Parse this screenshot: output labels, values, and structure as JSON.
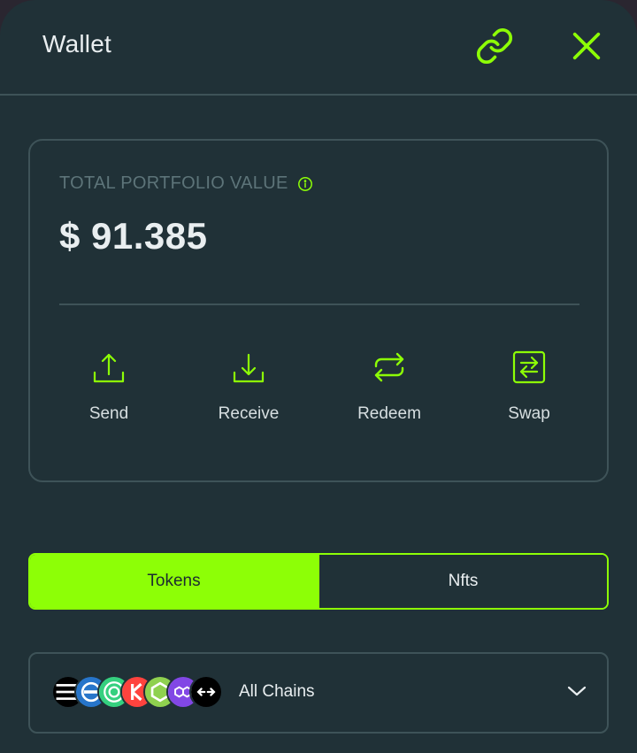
{
  "header": {
    "title": "Wallet",
    "link_icon": "link-icon",
    "close_icon": "close-icon"
  },
  "portfolio": {
    "label": "TOTAL PORTFOLIO VALUE",
    "info_icon": "info-icon",
    "value": "$ 91.385"
  },
  "actions": [
    {
      "label": "Send",
      "icon": "upload-icon"
    },
    {
      "label": "Receive",
      "icon": "download-icon"
    },
    {
      "label": "Redeem",
      "icon": "repeat-icon"
    },
    {
      "label": "Swap",
      "icon": "swap-icon"
    }
  ],
  "tabs": [
    {
      "label": "Tokens",
      "active": true
    },
    {
      "label": "Nfts",
      "active": false
    }
  ],
  "chain_selector": {
    "label": "All Chains",
    "chain_icons": [
      "solana-logo",
      "usdc-logo",
      "celo-logo",
      "kava-logo",
      "chainlink-logo",
      "polygon-logo",
      "bridge-logo"
    ],
    "chevron_icon": "chevron-down-icon"
  },
  "colors": {
    "accent": "#8dff06",
    "background": "#203137",
    "border": "#3e5358",
    "text": "#e9eef0",
    "muted": "#5d7479"
  }
}
